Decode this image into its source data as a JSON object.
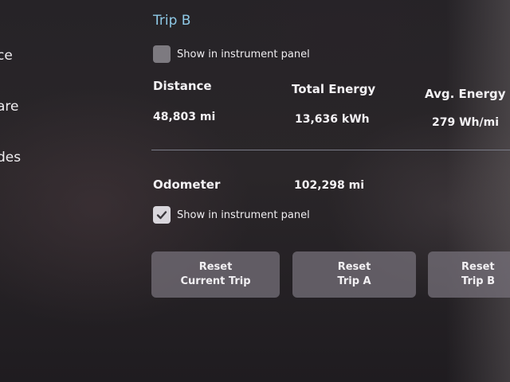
{
  "sidebar": {
    "items": [
      {
        "label": "ce"
      },
      {
        "label": "are"
      },
      {
        "label": "des"
      }
    ]
  },
  "trip_b": {
    "title": "Trip B",
    "show_in_panel": {
      "label": "Show in instrument panel",
      "checked": false
    },
    "distance": {
      "label": "Distance",
      "value": "48,803 mi"
    },
    "total_energy": {
      "label": "Total Energy",
      "value": "13,636 kWh"
    },
    "avg_energy": {
      "label": "Avg. Energy",
      "value": "279 Wh/mi"
    }
  },
  "odometer": {
    "label": "Odometer",
    "value": "102,298 mi",
    "show_in_panel": {
      "label": "Show in instrument panel",
      "checked": true
    }
  },
  "buttons": {
    "reset_current": {
      "line1": "Reset",
      "line2": "Current Trip"
    },
    "reset_a": {
      "line1": "Reset",
      "line2": "Trip A"
    },
    "reset_b": {
      "line1": "Reset",
      "line2": "Trip B"
    }
  },
  "colors": {
    "accent": "#8ec9e6",
    "button_bg": "#76707a",
    "divider": "#7a7c88"
  },
  "icons": {
    "checkmark": "check-icon"
  }
}
